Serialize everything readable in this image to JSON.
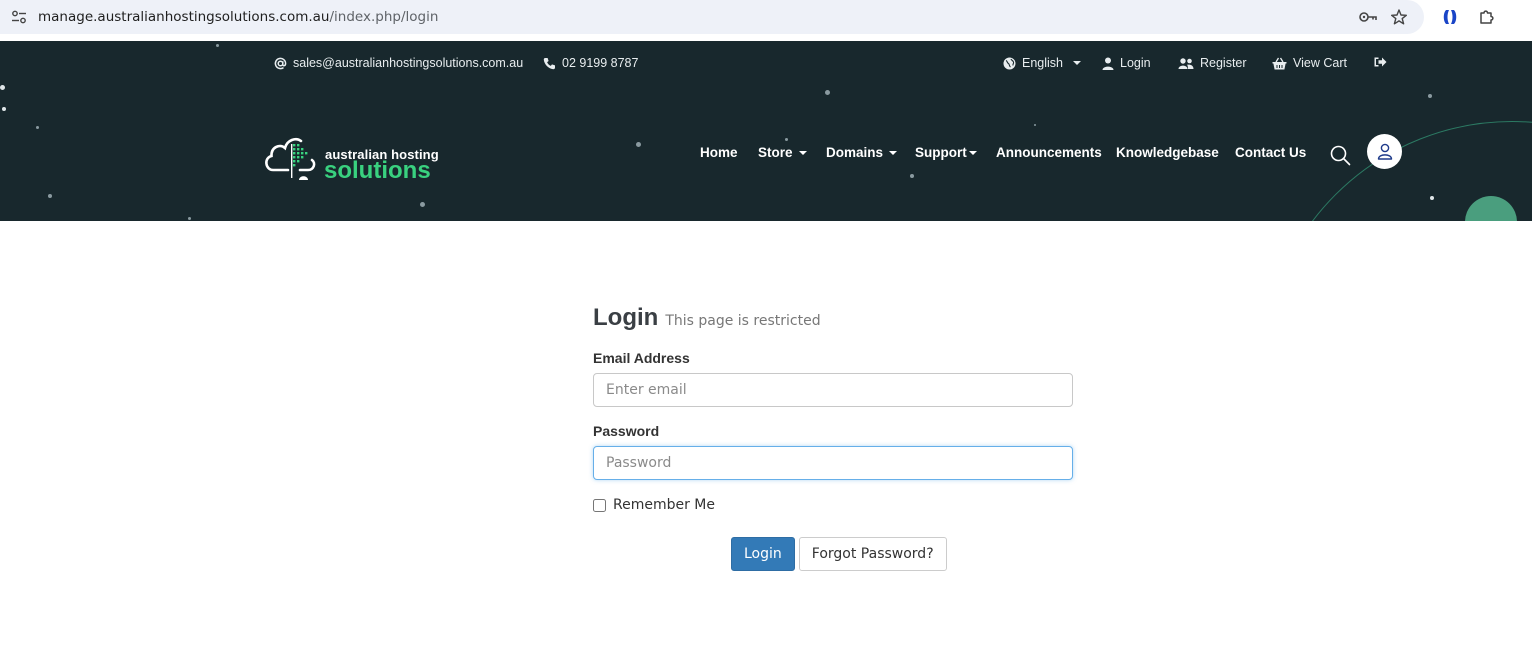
{
  "browser": {
    "url_host": "manage.australianhostingsolutions.com.au",
    "url_path": "/index.php/login"
  },
  "topbar": {
    "email": "sales@australianhostingsolutions.com.au",
    "phone": "02 9199 8787",
    "language": "English",
    "login": "Login",
    "register": "Register",
    "view_cart": "View Cart"
  },
  "logo": {
    "line1": "australian hosting",
    "line2": "solutions"
  },
  "nav": {
    "home": "Home",
    "store": "Store",
    "domains": "Domains",
    "support": "Support",
    "announcements": "Announcements",
    "knowledgebase": "Knowledgebase",
    "contact": "Contact Us"
  },
  "login": {
    "title": "Login",
    "subtitle": "This page is restricted",
    "email_label": "Email Address",
    "email_placeholder": "Enter email",
    "password_label": "Password",
    "password_placeholder": "Password",
    "remember_label": "Remember Me",
    "submit_label": "Login",
    "forgot_label": "Forgot Password?"
  },
  "colors": {
    "header_bg": "#18282d",
    "brand_green": "#39d17f",
    "primary_button": "#337ab7"
  }
}
